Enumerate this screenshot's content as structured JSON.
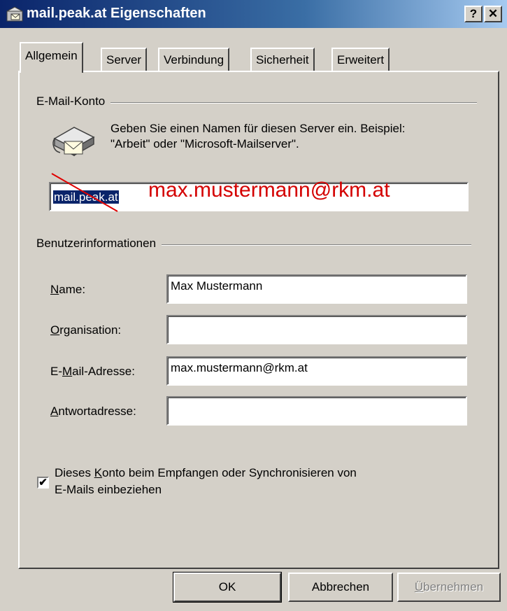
{
  "window": {
    "title": "mail.peak.at Eigenschaften",
    "help_label": "?",
    "close_label": "✕"
  },
  "tabs": [
    {
      "label": "Allgemein",
      "active": true
    },
    {
      "label": "Server",
      "active": false
    },
    {
      "label": "Verbindung",
      "active": false
    },
    {
      "label": "Sicherheit",
      "active": false
    },
    {
      "label": "Erweitert",
      "active": false
    }
  ],
  "account": {
    "group_label": "E-Mail-Konto",
    "hint_line1": "Geben Sie einen Namen für diesen Server ein. Beispiel:",
    "hint_line2": "\"Arbeit\" oder \"Microsoft-Mailserver\".",
    "name_value": "mail.peak.at",
    "overlay_annotation": "max.mustermann@rkm.at"
  },
  "user_info": {
    "group_label": "Benutzerinformationen",
    "name": {
      "label_hotkey": "N",
      "label_rest": "ame:",
      "value": "Max Mustermann"
    },
    "organisation": {
      "label_hotkey": "O",
      "label_rest": "rganisation:",
      "value": ""
    },
    "email": {
      "label_pre": "E-",
      "label_hotkey": "M",
      "label_rest": "ail-Adresse:",
      "value": "max.mustermann@rkm.at"
    },
    "reply": {
      "label_hotkey": "A",
      "label_rest": "ntwortadresse:",
      "value": ""
    }
  },
  "include_account": {
    "checked": true,
    "check_mark": "✔",
    "label_pre": "Dieses ",
    "label_hotkey": "K",
    "label_rest": "onto beim Empfangen oder Synchronisieren von",
    "label_line2": "E-Mails einbeziehen"
  },
  "buttons": {
    "ok": "OK",
    "cancel": "Abbrechen",
    "apply_hotkey": "Ü",
    "apply_rest": "bernehmen"
  }
}
